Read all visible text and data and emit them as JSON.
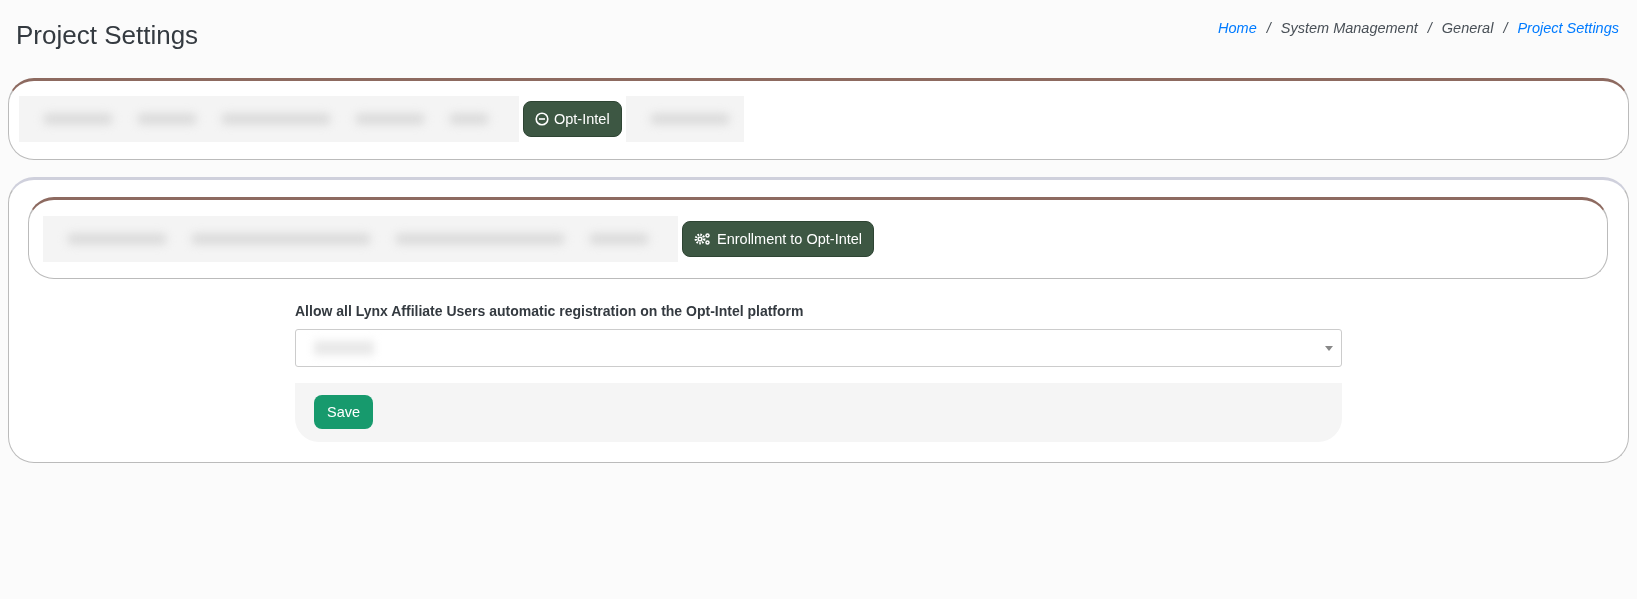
{
  "page_title": "Project Settings",
  "breadcrumb": {
    "separator": "/",
    "items": [
      {
        "label": "Home",
        "kind": "link"
      },
      {
        "label": "System Management",
        "kind": "text"
      },
      {
        "label": "General",
        "kind": "text"
      },
      {
        "label": "Project Settings",
        "kind": "current"
      }
    ]
  },
  "top_tabs": {
    "button": {
      "label": "Opt-Intel"
    }
  },
  "sub_tabs": {
    "button": {
      "label": "Enrollment to Opt-Intel"
    }
  },
  "form": {
    "label": "Allow all Lynx Affiliate Users automatic registration on the Opt-Intel platform",
    "save": "Save"
  }
}
